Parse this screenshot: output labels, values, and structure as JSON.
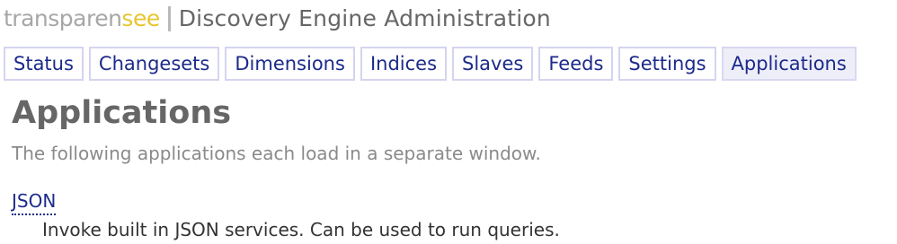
{
  "brand": {
    "part1": "transparen",
    "part2": "see",
    "color_part1": "#a7a7a7",
    "color_part2": "#e6c630"
  },
  "header": {
    "title": "Discovery Engine Administration"
  },
  "tabs": [
    {
      "label": "Status",
      "active": false
    },
    {
      "label": "Changesets",
      "active": false
    },
    {
      "label": "Dimensions",
      "active": false
    },
    {
      "label": "Indices",
      "active": false
    },
    {
      "label": "Slaves",
      "active": false
    },
    {
      "label": "Feeds",
      "active": false
    },
    {
      "label": "Settings",
      "active": false
    },
    {
      "label": "Applications",
      "active": true
    }
  ],
  "main": {
    "title": "Applications",
    "intro": "The following applications each load in a separate window.",
    "applications": [
      {
        "name": "JSON",
        "description": "Invoke built in JSON services. Can be used to run queries."
      }
    ]
  },
  "colors": {
    "link": "#1c2a8a",
    "tab_border": "#d4d4f0",
    "tab_active_bg": "#eeeef9"
  }
}
